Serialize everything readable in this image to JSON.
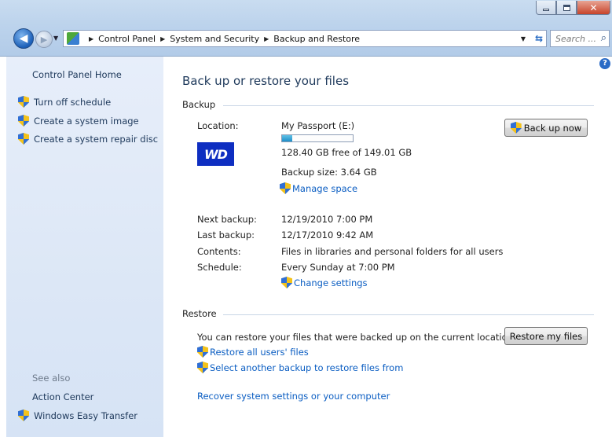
{
  "window": {
    "search_placeholder": "Search ...",
    "breadcrumbs": [
      "Control Panel",
      "System and Security",
      "Backup and Restore"
    ]
  },
  "left_pane": {
    "home": "Control Panel Home",
    "tasks": [
      "Turn off schedule",
      "Create a system image",
      "Create a system repair disc"
    ],
    "see_also_title": "See also",
    "see_also": [
      "Action Center",
      "Windows Easy Transfer"
    ]
  },
  "main": {
    "title": "Back up or restore your files",
    "backup": {
      "section": "Backup",
      "location_label": "Location:",
      "location_value": "My Passport (E:)",
      "free_space": "128.40 GB free of 149.01 GB",
      "used_fraction": 0.14,
      "backup_size": "Backup size: 3.64 GB",
      "manage_space": "Manage space",
      "back_up_now": "Back up now",
      "drive_logo_text": "WD",
      "rows": [
        {
          "label": "Next backup:",
          "value": "12/19/2010 7:00 PM"
        },
        {
          "label": "Last backup:",
          "value": "12/17/2010 9:42 AM"
        },
        {
          "label": "Contents:",
          "value": "Files in libraries and personal folders for all users"
        },
        {
          "label": "Schedule:",
          "value": "Every Sunday at 7:00 PM"
        }
      ],
      "change_settings": "Change settings"
    },
    "restore": {
      "section": "Restore",
      "description": "You can restore your files that were backed up on the current location.",
      "restore_my_files": "Restore my files",
      "restore_all_users": "Restore all users' files",
      "select_another": "Select another backup to restore files from",
      "recover_system": "Recover system settings or your computer"
    }
  },
  "colors": {
    "link": "#0a5dc2",
    "heading": "#1e395b",
    "left_pane_bg": "#dce7f6",
    "wd_blue": "#0e2ec1"
  }
}
